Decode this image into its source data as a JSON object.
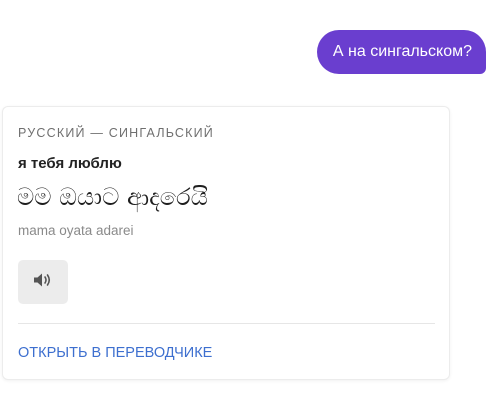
{
  "chat": {
    "user_message": "А на сингальском?"
  },
  "translation_card": {
    "language_pair": "Русский — Сингальский",
    "source_text": "я тебя люблю",
    "translated_text": "මම ඔයාට ආදරෙයි",
    "transliteration": "mama oyata adarei",
    "audio_icon": "speaker-icon",
    "open_link_label": "Открыть в переводчике"
  },
  "colors": {
    "user_bubble_bg": "#6a3ecf",
    "link": "#3d6fcf",
    "audio_button_bg": "#ececec"
  }
}
